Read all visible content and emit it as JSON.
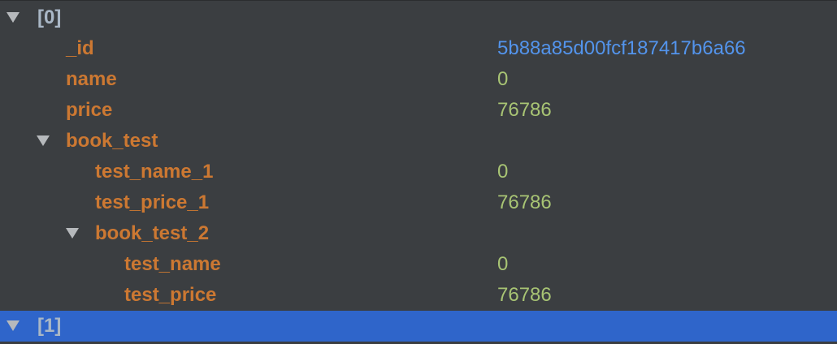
{
  "colors": {
    "background": "#3b3e41",
    "selected_row": "#2f65ca",
    "field_key": "#cc7832",
    "index_key": "#a9b7c6",
    "number_value": "#a8c474",
    "objectid_value": "#5394ec",
    "toggle_arrow": "#b6b9bc"
  },
  "icons": {
    "expanded": "triangle-down-icon"
  },
  "rows": [
    {
      "label": "[0]",
      "kind": "index",
      "expanded": true,
      "value": ""
    },
    {
      "label": "_id",
      "kind": "field",
      "value": "5b88a85d00fcf187417b6a66",
      "value_type": "objectid"
    },
    {
      "label": "name",
      "kind": "field",
      "value": "0",
      "value_type": "number"
    },
    {
      "label": "price",
      "kind": "field",
      "value": "76786",
      "value_type": "number"
    },
    {
      "label": "book_test",
      "kind": "field",
      "expanded": true,
      "value": ""
    },
    {
      "label": "test_name_1",
      "kind": "field",
      "value": "0",
      "value_type": "number"
    },
    {
      "label": "test_price_1",
      "kind": "field",
      "value": "76786",
      "value_type": "number"
    },
    {
      "label": "book_test_2",
      "kind": "field",
      "expanded": true,
      "value": ""
    },
    {
      "label": "test_name",
      "kind": "field",
      "value": "0",
      "value_type": "number"
    },
    {
      "label": "test_price",
      "kind": "field",
      "value": "76786",
      "value_type": "number"
    },
    {
      "label": "[1]",
      "kind": "index",
      "expanded": true,
      "selected": true,
      "value": ""
    }
  ]
}
